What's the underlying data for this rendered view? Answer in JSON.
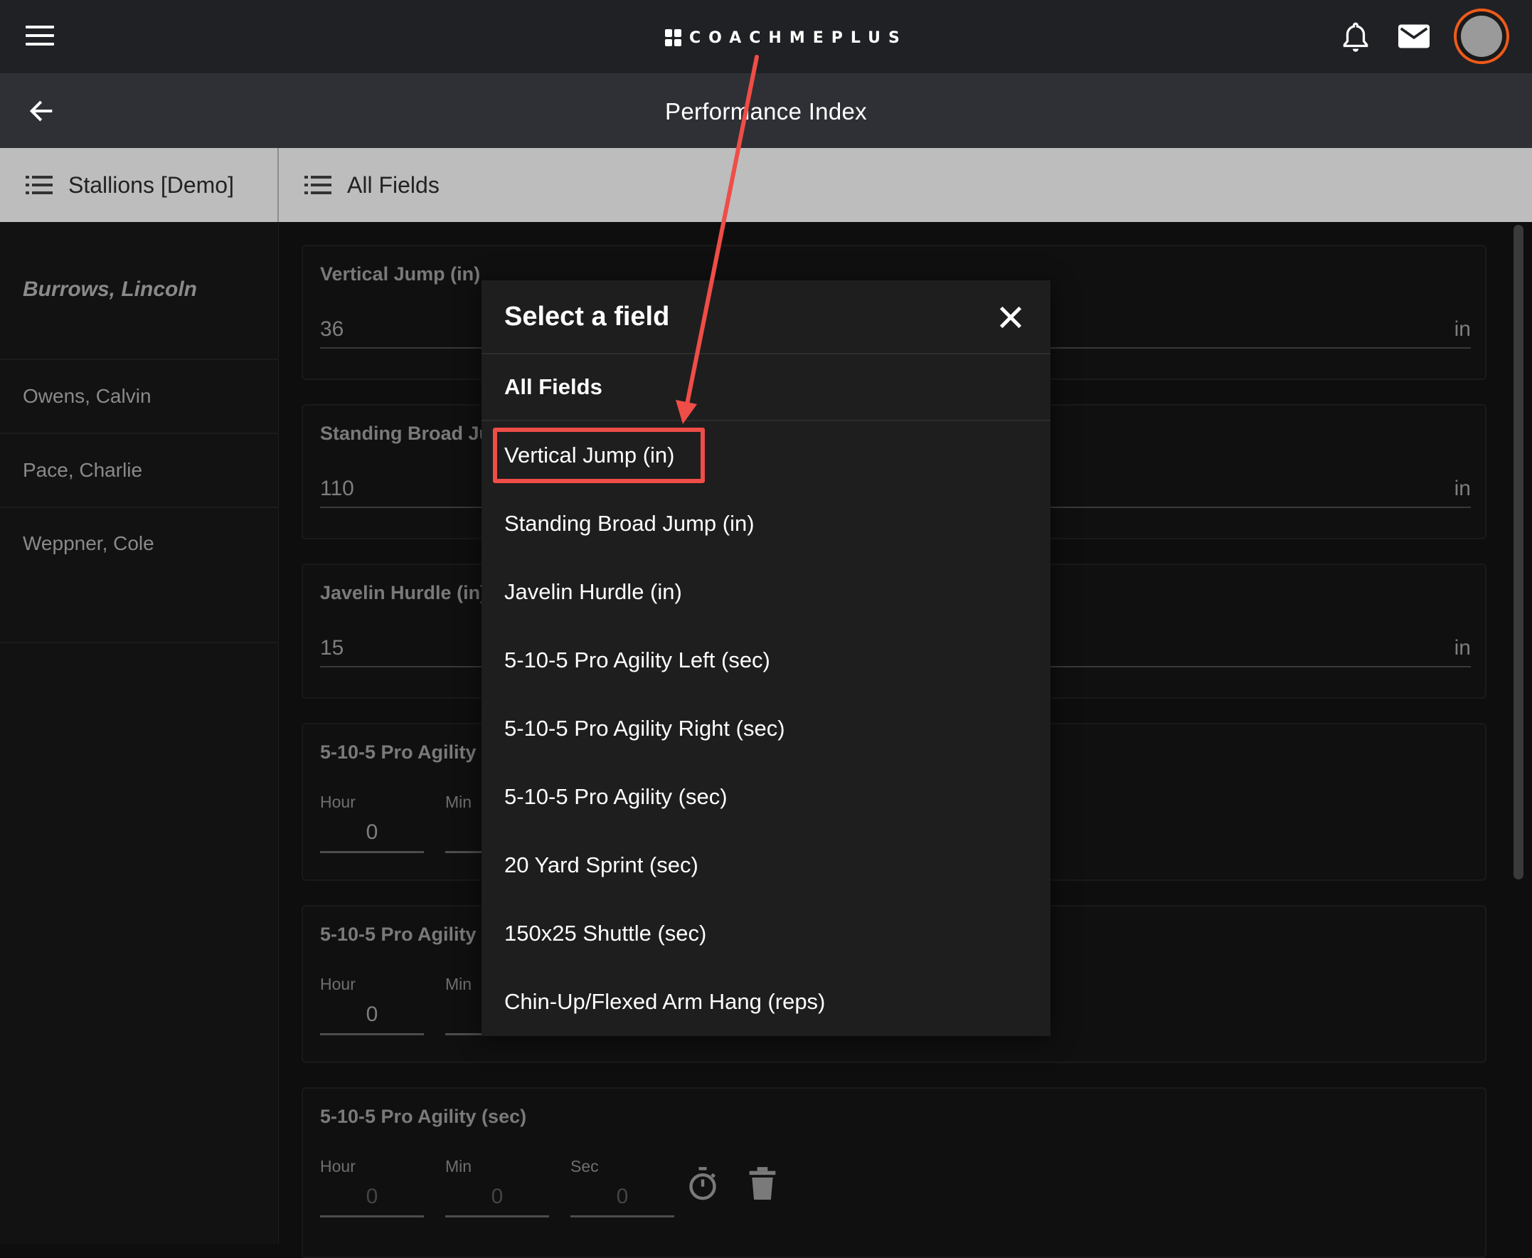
{
  "brand": {
    "logo_text": "COACHMEPLUS"
  },
  "header": {
    "title": "Performance Index"
  },
  "toolbar": {
    "team_label": "Stallions [Demo]",
    "fields_label": "All Fields"
  },
  "sidebar": {
    "current_athlete": "Burrows, Lincoln",
    "athletes": [
      "Owens, Calvin",
      "Pace, Charlie",
      "Weppner, Cole"
    ]
  },
  "cards": [
    {
      "title": "Vertical Jump (in)",
      "value": "36",
      "unit": "in"
    },
    {
      "title": "Standing Broad Ju",
      "value": "110",
      "unit": "in"
    },
    {
      "title": "Javelin Hurdle (in)",
      "value": "15",
      "unit": "in"
    },
    {
      "title": "5-10-5 Pro Agility",
      "hour_label": "Hour",
      "min_label": "Min",
      "hour_value": "0"
    },
    {
      "title": "5-10-5 Pro Agility",
      "hour_label": "Hour",
      "min_label": "Min",
      "hour_value": "0"
    },
    {
      "title": "5-10-5 Pro Agility (sec)",
      "hour_label": "Hour",
      "min_label": "Min",
      "sec_label": "Sec",
      "hour_placeholder": "0",
      "min_placeholder": "0",
      "sec_placeholder": "0"
    }
  ],
  "modal": {
    "title": "Select a field",
    "all_label": "All Fields",
    "items": [
      "Vertical Jump (in)",
      "Standing Broad Jump (in)",
      "Javelin Hurdle (in)",
      "5-10-5 Pro Agility Left (sec)",
      "5-10-5 Pro Agility Right (sec)",
      "5-10-5 Pro Agility (sec)",
      "20 Yard Sprint (sec)",
      "150x25 Shuttle (sec)",
      "Chin-Up/Flexed Arm Hang (reps)"
    ]
  },
  "colors": {
    "accent": "#f05a1a",
    "annotation": "#ef4d47",
    "toolbar": "#bdbdbd"
  },
  "icons": [
    "menu-icon",
    "bell-icon",
    "mail-icon",
    "back-arrow-icon",
    "list-icon",
    "close-icon",
    "stopwatch-icon",
    "trash-icon"
  ]
}
